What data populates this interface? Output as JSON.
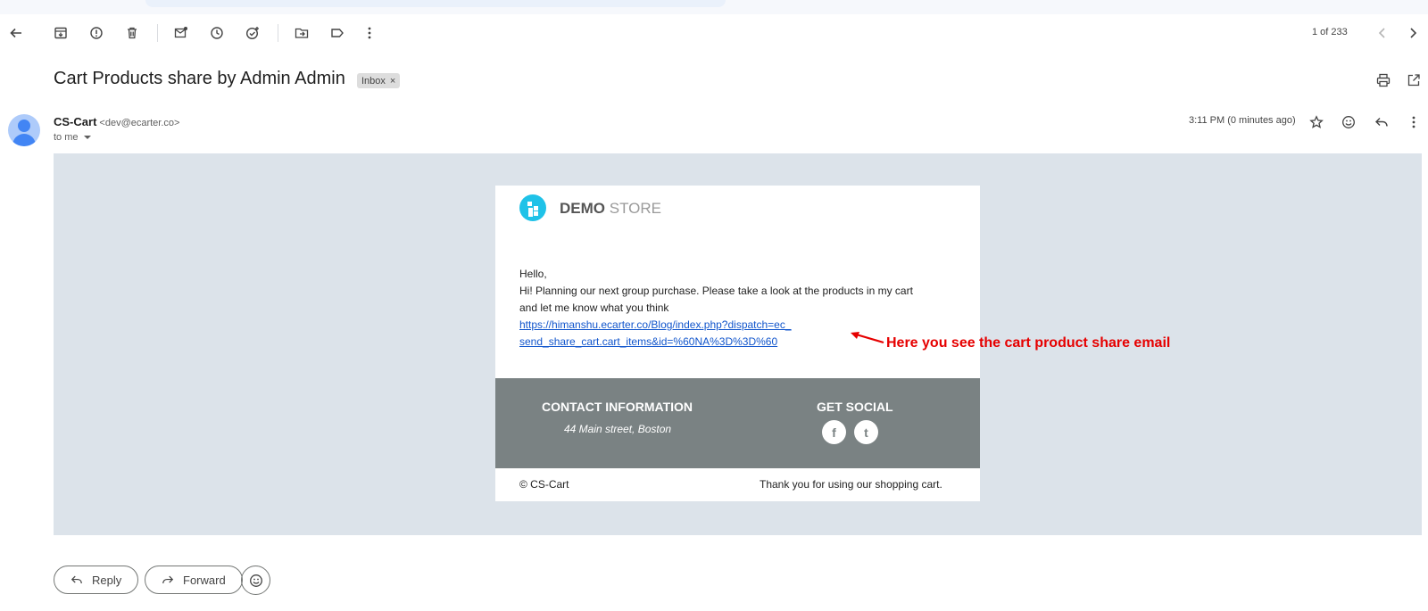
{
  "toolbar": {
    "pager_text": "1 of 233",
    "icons": [
      "back-arrow-icon",
      "archive-icon",
      "report-spam-icon",
      "delete-icon",
      "mark-unread-icon",
      "snooze-icon",
      "add-to-tasks-icon",
      "move-to-icon",
      "label-icon",
      "more-vert-icon",
      "chevron-left-icon",
      "chevron-right-icon"
    ]
  },
  "message": {
    "subject": "Cart Products share by Admin Admin",
    "label_chip": "Inbox",
    "chip_close": "×",
    "sender_name": "CS-Cart",
    "sender_email": "<dev@ecarter.co>",
    "recipient_text": "to me",
    "timestamp": "3:11 PM (0 minutes ago)"
  },
  "email_card": {
    "brand_bold": "DEMO",
    "brand_light": "STORE",
    "greeting": "Hello,",
    "body_line1": "Hi! Planning our next group purchase. Please take a look at the products in my cart",
    "body_line2": "and let me know what you think",
    "link_line1": "https://himanshu.ecarter.co/Blog/index.php?dispatch=ec_",
    "link_line2": "send_share_cart.cart_items&id=%60NA%3D%3D%60",
    "footer_contact_title": "CONTACT INFORMATION",
    "footer_address": "44 Main street, Boston",
    "footer_social_title": "GET SOCIAL",
    "social_facebook": "f",
    "social_twitter": "t",
    "copyright": "© CS-Cart",
    "thanks": "Thank you for using our shopping cart."
  },
  "annotation": {
    "text": "Here you see the cart product share email",
    "color": "#e60000"
  },
  "actions": {
    "reply_label": "Reply",
    "forward_label": "Forward"
  }
}
